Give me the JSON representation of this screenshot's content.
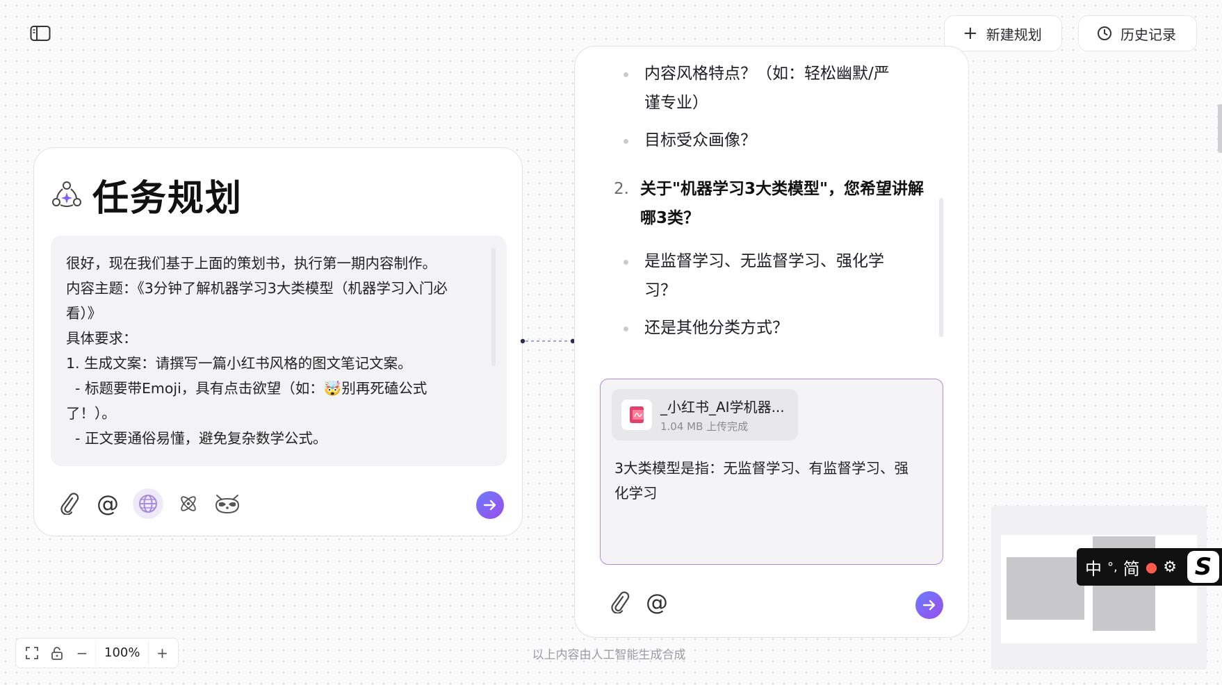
{
  "header": {
    "new_plan_label": "新建规划",
    "history_label": "历史记录"
  },
  "plan_card": {
    "title": "任务规划",
    "prompt_lines": [
      "很好，现在我们基于上面的策划书，执行第一期内容制作。",
      "内容主题：《3分钟了解机器学习3大类模型（机器学习入门必",
      "看）》",
      "具体要求：",
      "1. 生成文案：请撰写一篇小红书风格的图文笔记文案。",
      "  - 标题要带Emoji，具有点击欲望（如：🤯别再死磕公式",
      "了！）。",
      "  - 正文要通俗易懂，避免复杂数学公式。"
    ]
  },
  "chat_card": {
    "bullets_top": [
      "内容风格特点？（如：轻松幽默/严",
      "谨专业）",
      "目标受众画像？"
    ],
    "item2_number": "2.",
    "item2_line1": "关于\"机器学习3大类模型\"，您希望讲解",
    "item2_line2": "哪3类？",
    "bullets_bottom": [
      "是监督学习、无监督学习、强化学",
      "习？",
      "还是其他分类方式？"
    ],
    "file": {
      "name": "_小红书_AI学机器...",
      "meta": "1.04 MB 上传完成"
    },
    "input_lines": [
      "3大类模型是指：无监督学习、有监督学习、强",
      "化学习"
    ]
  },
  "ime": {
    "chars": [
      "中",
      "°,",
      "简"
    ]
  },
  "ime_logo": "S",
  "zoom": {
    "level": "100%",
    "minus": "−",
    "plus": "+"
  },
  "footer": {
    "disclaimer": "以上内容由人工智能生成合成"
  },
  "colors": {
    "accent_gradient_start": "#6b7cff",
    "accent_gradient_end": "#9a4de8",
    "input_border": "#a98be0",
    "file_icon": "#e2416b"
  }
}
